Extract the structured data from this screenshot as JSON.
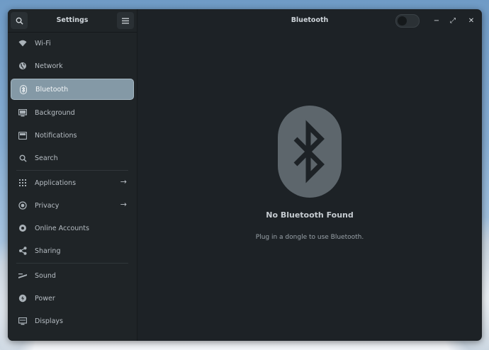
{
  "sidebar": {
    "title": "Settings",
    "search_icon": "search-icon",
    "menu_icon": "hamburger-icon",
    "items": [
      {
        "id": "wifi",
        "label": "Wi-Fi",
        "icon": "wifi-icon"
      },
      {
        "id": "network",
        "label": "Network",
        "icon": "globe-icon"
      },
      {
        "id": "bluetooth",
        "label": "Bluetooth",
        "icon": "bluetooth-icon",
        "active": true
      },
      {
        "id": "background",
        "label": "Background",
        "icon": "monitor-icon"
      },
      {
        "id": "notifications",
        "label": "Notifications",
        "icon": "bell-icon"
      },
      {
        "id": "search",
        "label": "Search",
        "icon": "search-icon"
      },
      {
        "id": "applications",
        "label": "Applications",
        "icon": "grid-icon",
        "arrow": true
      },
      {
        "id": "privacy",
        "label": "Privacy",
        "icon": "privacy-icon",
        "arrow": true
      },
      {
        "id": "online-accounts",
        "label": "Online Accounts",
        "icon": "accounts-icon"
      },
      {
        "id": "sharing",
        "label": "Sharing",
        "icon": "share-icon"
      },
      {
        "id": "sound",
        "label": "Sound",
        "icon": "speaker-icon"
      },
      {
        "id": "power",
        "label": "Power",
        "icon": "power-icon"
      },
      {
        "id": "displays",
        "label": "Displays",
        "icon": "display-icon"
      }
    ]
  },
  "header": {
    "title": "Bluetooth",
    "toggle_on": false
  },
  "window_controls": {
    "minimize": "−",
    "maximize": "⤢",
    "close": "✕"
  },
  "empty_state": {
    "title": "No Bluetooth Found",
    "subtitle": "Plug in a dongle to use Bluetooth."
  },
  "colors": {
    "accent": "#8499a6",
    "window_bg": "#1d2226",
    "badge": "#5d666c"
  }
}
